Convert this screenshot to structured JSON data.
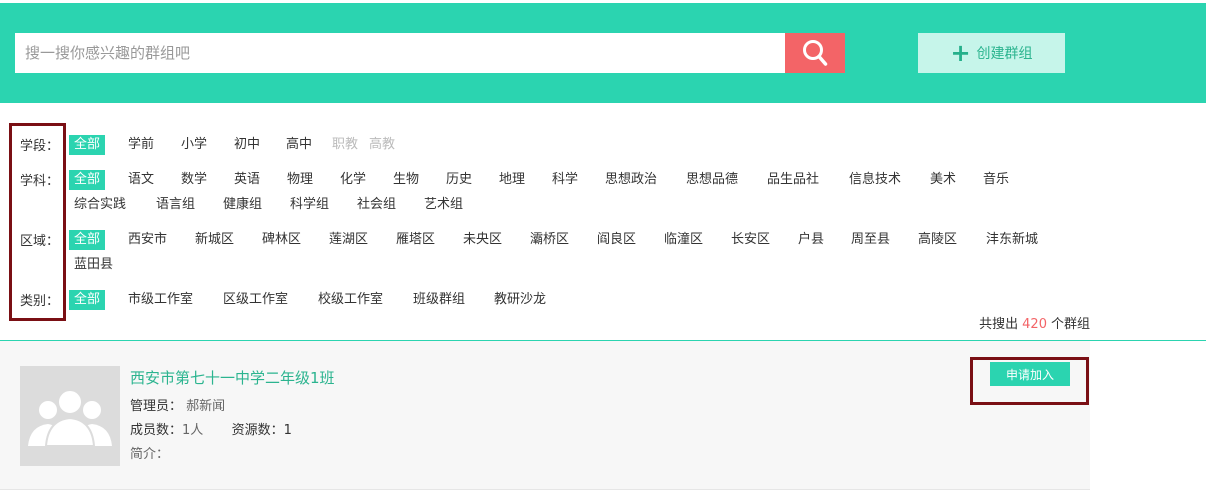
{
  "header": {
    "search_placeholder": "搜一搜你感兴趣的群组吧",
    "search_icon": "search-icon",
    "create_label": "创建群组",
    "create_icon": "plus-icon",
    "accent_color": "#2bd4b0",
    "search_button_color": "#f36467"
  },
  "filters": {
    "stage": {
      "label": "学段：",
      "options": [
        "全部",
        "学前",
        "小学",
        "初中",
        "高中",
        "职教",
        "高教"
      ]
    },
    "subject": {
      "label": "学科：",
      "options": [
        "全部",
        "语文",
        "数学",
        "英语",
        "物理",
        "化学",
        "生物",
        "历史",
        "地理",
        "科学",
        "思想政治",
        "思想品德",
        "品生品社",
        "信息技术",
        "美术",
        "音乐",
        "综合实践",
        "语言组",
        "健康组",
        "科学组",
        "社会组",
        "艺术组"
      ]
    },
    "region": {
      "label": "区域：",
      "options": [
        "全部",
        "西安市",
        "新城区",
        "碑林区",
        "莲湖区",
        "雁塔区",
        "未央区",
        "灞桥区",
        "阎良区",
        "临潼区",
        "长安区",
        "户县",
        "周至县",
        "高陵区",
        "沣东新城",
        "蓝田县"
      ]
    },
    "type": {
      "label": "类别：",
      "options": [
        "全部",
        "市级工作室",
        "区级工作室",
        "校级工作室",
        "班级群组",
        "教研沙龙"
      ]
    }
  },
  "results": {
    "prefix": "共搜出",
    "count": "420",
    "suffix": "个群组"
  },
  "groups": [
    {
      "name": "西安市第七十一中学二年级1班",
      "admin_label": "管理员：",
      "admin": "郝新闻",
      "members_label": "成员数：",
      "members": "1人",
      "resources_label": "资源数：",
      "resources": "1",
      "intro_label": "简介：",
      "join_label": "申请加入",
      "avatar_icon": "group-avatar-icon"
    }
  ]
}
